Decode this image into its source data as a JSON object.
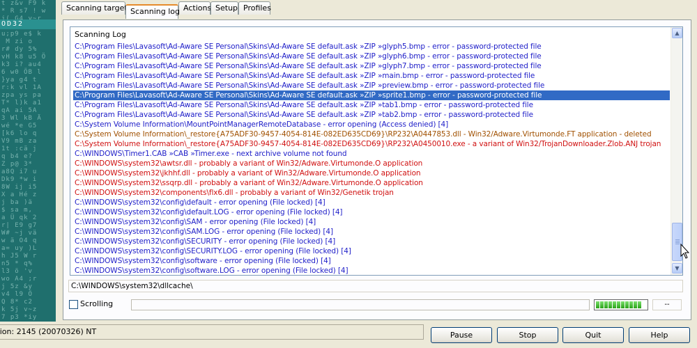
{
  "sidebar": {
    "label": "OD32",
    "glyphs": "t z&v F9 k\n* R s7 ! w\nj( G4 y~r\nQ2 'Sp l9\nu;p9 e$ k\n M zi o\nr# dy 5%\nvH k8 u5 Ö\nk3 i? au4\n6 w0 ÖB l\n}ya g4 t\nr:k vl 1A\nzpa ys pa\nT* l)k a1\nqA ai 5A\n3 Wl kB Ä\nwé *e G5\n[k6 lo q\nV9 mB za\n1t :cä j\nq b4 e?\nZ p@ 3*\na8Q i7 u\nDk9 *w i\n8W ij i5\nX a Hé z\nj ba )ä\n$ sa m,\na Ü qk 2\nr| E9 g7\nW# ~j vä\nw ä O4 q\na= uy )L\nh J5 W r\nn5 * q%\nl3 ö 'v\nwo A4 ;r\nj 5z &y\nv4 l9 Ö\nQ 8* c2\nk 5j v~z\n7 p3 *iy"
  },
  "tabs": [
    {
      "label": "Scanning targets",
      "active": false
    },
    {
      "label": "Scanning log",
      "active": true
    },
    {
      "label": "Actions",
      "active": false
    },
    {
      "label": "Setup",
      "active": false
    },
    {
      "label": "Profiles",
      "active": false
    }
  ],
  "log": {
    "header": "Scanning Log",
    "lines": [
      {
        "text": "C:\\Program Files\\Lavasoft\\Ad-Aware SE Personal\\Skins\\Ad-Aware SE default.ask »ZIP »glyph5.bmp - error - password-protected file",
        "color": "blue"
      },
      {
        "text": "C:\\Program Files\\Lavasoft\\Ad-Aware SE Personal\\Skins\\Ad-Aware SE default.ask »ZIP »glyph6.bmp - error - password-protected file",
        "color": "blue"
      },
      {
        "text": "C:\\Program Files\\Lavasoft\\Ad-Aware SE Personal\\Skins\\Ad-Aware SE default.ask »ZIP »glyph7.bmp - error - password-protected file",
        "color": "blue"
      },
      {
        "text": "C:\\Program Files\\Lavasoft\\Ad-Aware SE Personal\\Skins\\Ad-Aware SE default.ask »ZIP »main.bmp - error - password-protected file",
        "color": "blue"
      },
      {
        "text": "C:\\Program Files\\Lavasoft\\Ad-Aware SE Personal\\Skins\\Ad-Aware SE default.ask »ZIP »preview.bmp - error - password-protected file",
        "color": "blue"
      },
      {
        "text": "C:\\Program Files\\Lavasoft\\Ad-Aware SE Personal\\Skins\\Ad-Aware SE default.ask »ZIP »sprite1.bmp - error - password-protected file",
        "color": "selected"
      },
      {
        "text": "C:\\Program Files\\Lavasoft\\Ad-Aware SE Personal\\Skins\\Ad-Aware SE default.ask »ZIP »tab1.bmp - error - password-protected file",
        "color": "blue"
      },
      {
        "text": "C:\\Program Files\\Lavasoft\\Ad-Aware SE Personal\\Skins\\Ad-Aware SE default.ask »ZIP »tab2.bmp - error - password-protected file",
        "color": "blue"
      },
      {
        "text": "C:\\System Volume Information\\MountPointManagerRemoteDatabase - error opening (Access denied) [4]",
        "color": "blue"
      },
      {
        "text": "C:\\System Volume Information\\_restore{A75ADF30-9457-4054-814E-082ED635CD69}\\RP232\\A0447853.dll - Win32/Adware.Virtumonde.FT application - deleted",
        "color": "brown"
      },
      {
        "text": "C:\\System Volume Information\\_restore{A75ADF30-9457-4054-814E-082ED635CD69}\\RP232\\A0450010.exe - a variant of Win32/TrojanDownloader.Zlob.ANJ trojan",
        "color": "red"
      },
      {
        "text": "C:\\WINDOWS\\Timer1.CAB »CAB »Timer.exe - next archive volume not found",
        "color": "blue"
      },
      {
        "text": "C:\\WINDOWS\\system32\\awtsr.dll - probably a variant of Win32/Adware.Virtumonde.O application",
        "color": "red"
      },
      {
        "text": "C:\\WINDOWS\\system32\\jkhhf.dll - probably a variant of Win32/Adware.Virtumonde.O application",
        "color": "red"
      },
      {
        "text": "C:\\WINDOWS\\system32\\ssqrp.dll - probably a variant of Win32/Adware.Virtumonde.O application",
        "color": "red"
      },
      {
        "text": "C:\\WINDOWS\\system32\\components\\flx6.dll - probably a variant of Win32/Genetik trojan",
        "color": "red"
      },
      {
        "text": "C:\\WINDOWS\\system32\\config\\default - error opening (File locked) [4]",
        "color": "blue"
      },
      {
        "text": "C:\\WINDOWS\\system32\\config\\default.LOG - error opening (File locked) [4]",
        "color": "blue"
      },
      {
        "text": "C:\\WINDOWS\\system32\\config\\SAM - error opening (File locked) [4]",
        "color": "blue"
      },
      {
        "text": "C:\\WINDOWS\\system32\\config\\SAM.LOG - error opening (File locked) [4]",
        "color": "blue"
      },
      {
        "text": "C:\\WINDOWS\\system32\\config\\SECURITY - error opening (File locked) [4]",
        "color": "blue"
      },
      {
        "text": "C:\\WINDOWS\\system32\\config\\SECURITY.LOG - error opening (File locked) [4]",
        "color": "blue"
      },
      {
        "text": "C:\\WINDOWS\\system32\\config\\software - error opening (File locked) [4]",
        "color": "blue"
      },
      {
        "text": "C:\\WINDOWS\\system32\\config\\software.LOG - error opening (File locked) [4]",
        "color": "blue"
      }
    ]
  },
  "current_path": "C:\\WINDOWS\\system32\\dllcache\\",
  "scrolling": {
    "label": "Scrolling",
    "checked": false
  },
  "progress": {
    "segments": 11,
    "count": "--"
  },
  "status": {
    "text": "sion: 2145 (20070326) NT"
  },
  "buttons": {
    "pause": "Pause",
    "stop": "Stop",
    "quit": "Quit",
    "help": "Help"
  },
  "colors": {
    "blue": "#1d1dc8",
    "red": "#d01010",
    "brown": "#a05000",
    "selection": "#316AC5",
    "tab_accent": "#E68B2C"
  }
}
